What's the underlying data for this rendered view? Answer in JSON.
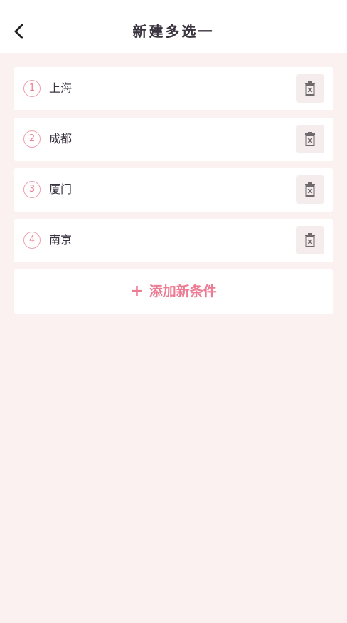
{
  "header": {
    "title": "新建多选一",
    "back_icon": "chevron-left-icon"
  },
  "options": [
    {
      "number": "1",
      "label": "上海"
    },
    {
      "number": "2",
      "label": "成都"
    },
    {
      "number": "3",
      "label": "厦门"
    },
    {
      "number": "4",
      "label": "南京"
    }
  ],
  "add_button": {
    "icon": "+",
    "label": "添加新条件"
  },
  "colors": {
    "accent": "#ec7c94",
    "background": "#fbf1f1",
    "delete_bg": "#f5eded",
    "delete_icon": "#6e6a6e"
  }
}
